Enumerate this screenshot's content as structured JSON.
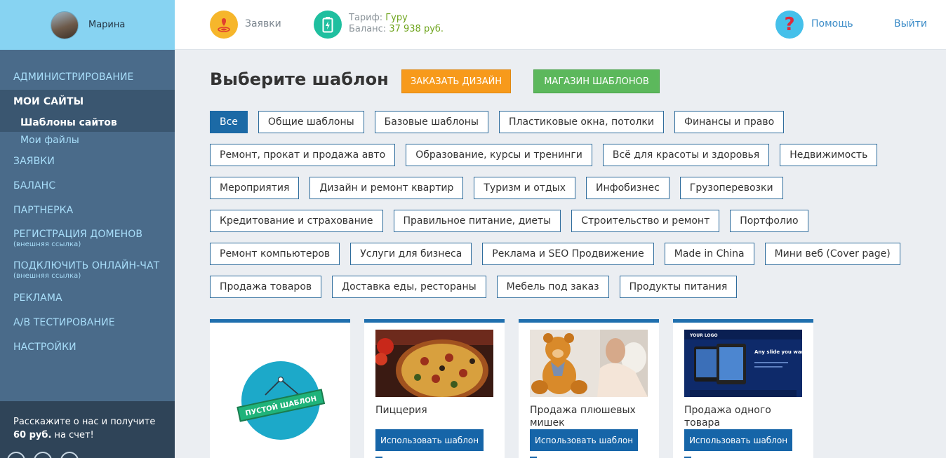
{
  "user": {
    "name": "Марина"
  },
  "header": {
    "orders_label": "Заявки",
    "tariff_label": "Тариф:",
    "tariff_value": "Гуру",
    "balance_label": "Баланс:",
    "balance_value": "37 938 руб.",
    "help_label": "Помощь",
    "logout_label": "Выйти"
  },
  "sidebar": {
    "admin": "АДМИНИСТРИРОВАНИЕ",
    "my_sites": "МОИ САЙТЫ",
    "templates": "Шаблоны сайтов",
    "my_files": "Мои файлы",
    "orders": "ЗАЯВКИ",
    "balance": "БАЛАНС",
    "partner": "ПАРТНЕРКА",
    "domains": "РЕГИСТРАЦИЯ ДОМЕНОВ",
    "domains_note": "(внешняя ссылка)",
    "chat": "ПОДКЛЮЧИТЬ ОНЛАЙН-ЧАТ",
    "chat_note": "(внешняя ссылка)",
    "ads": "РЕКЛАМА",
    "ab": "А/В ТЕСТИРОВАНИЕ",
    "settings": "НАСТРОЙКИ",
    "promo_pre": "Расскажите о нас и получите",
    "promo_amount": "60 руб.",
    "promo_post": " на счет!"
  },
  "main": {
    "title": "Выберите шаблон",
    "order_design": "ЗАКАЗАТЬ ДИЗАЙН",
    "template_shop": "МАГАЗИН ШАБЛОНОВ"
  },
  "categories": [
    [
      "Все",
      "Общие шаблоны",
      "Базовые шаблоны",
      "Пластиковые окна, потолки",
      "Финансы и право"
    ],
    [
      "Ремонт, прокат и продажа авто",
      "Образование, курсы и тренинги",
      "Всё для красоты и здоровья",
      "Недвижимость"
    ],
    [
      "Мероприятия",
      "Дизайн и ремонт квартир",
      "Туризм и отдых",
      "Инфобизнес",
      "Грузоперевозки"
    ],
    [
      "Кредитование и страхование",
      "Правильное питание, диеты",
      "Строительство и ремонт",
      "Портфолио"
    ],
    [
      "Ремонт компьютеров",
      "Услуги для бизнеса",
      "Реклама и SEO Продвижение",
      "Made in China",
      "Мини веб (Cover page)"
    ],
    [
      "Продажа товаров",
      "Доставка еды, рестораны",
      "Мебель под заказ",
      "Продукты питания"
    ]
  ],
  "cards": {
    "empty_label": "ПУСТОЙ ШАБЛОН",
    "use_label": "Использовать шаблон",
    "items": [
      {
        "title": "Пиццерия"
      },
      {
        "title": "Продажа плюшевых мишек"
      },
      {
        "title": "Продажа одного товара"
      }
    ],
    "slide_logo": "YOUR LOGO",
    "slide_text": "Any slide you want"
  },
  "colors": {
    "sidebar": "#4a6b8a",
    "sidebar_top": "#87d3f2",
    "accent_blue": "#1c6aa6",
    "orange": "#f79a1b",
    "green": "#5cb85c",
    "link": "#3a8bc7"
  }
}
